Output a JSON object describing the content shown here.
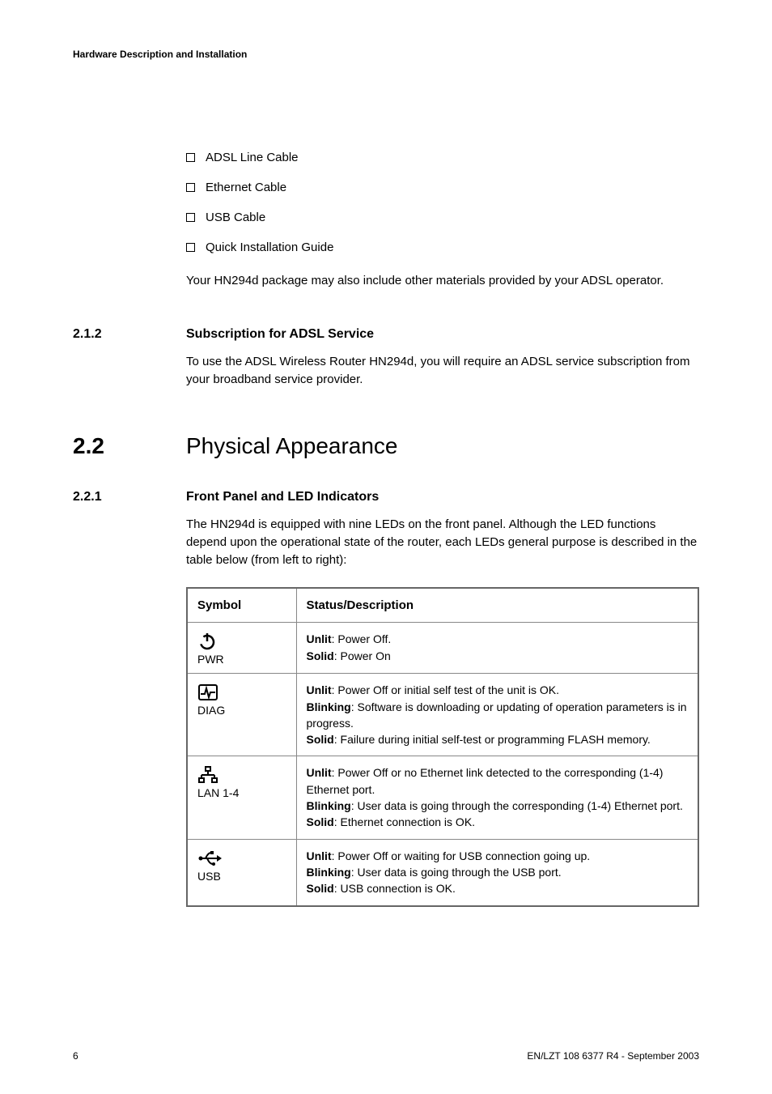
{
  "header": "Hardware Description and Installation",
  "bullets": [
    "ADSL Line Cable",
    "Ethernet Cable",
    "USB Cable",
    "Quick Installation Guide"
  ],
  "intro_para": "Your HN294d package may also include other materials provided by your ADSL operator.",
  "sec_212_num": "2.1.2",
  "sec_212_title": "Subscription for ADSL Service",
  "sec_212_body": "To use the ADSL Wireless Router HN294d, you will require an ADSL service subscription from your broadband service provider.",
  "sec_22_num": "2.2",
  "sec_22_title": "Physical Appearance",
  "sec_221_num": "2.2.1",
  "sec_221_title": "Front Panel and LED Indicators",
  "sec_221_body": "The HN294d is equipped with nine LEDs on the front panel. Although the LED functions depend upon the operational state of the router, each LEDs general purpose is described in the table below (from left to right):",
  "table": {
    "h1": "Symbol",
    "h2": "Status/Description",
    "rows": [
      {
        "label": "PWR",
        "lines": [
          {
            "b": "Unlit",
            "t": ": Power Off."
          },
          {
            "b": "Solid",
            "t": ": Power On"
          }
        ]
      },
      {
        "label": "DIAG",
        "lines": [
          {
            "b": "Unlit",
            "t": ": Power Off or initial self test of the unit is OK."
          },
          {
            "b": "Blinking",
            "t": ": Software is downloading or updating of operation parameters is in progress."
          },
          {
            "b": "Solid",
            "t": ": Failure during initial self-test or programming FLASH memory."
          }
        ]
      },
      {
        "label": "LAN 1-4",
        "lines": [
          {
            "b": "Unlit",
            "t": ": Power Off or no Ethernet link detected to the corresponding (1-4) Ethernet port."
          },
          {
            "b": "Blinking",
            "t": ": User data is going through the corresponding (1-4) Ethernet port."
          },
          {
            "b": "Solid",
            "t": ": Ethernet connection is OK."
          }
        ]
      },
      {
        "label": "USB",
        "lines": [
          {
            "b": "Unlit",
            "t": ": Power Off or waiting for USB connection going up."
          },
          {
            "b": "Blinking",
            "t": ": User data is going through the USB port."
          },
          {
            "b": "Solid",
            "t": ": USB connection is OK."
          }
        ]
      }
    ]
  },
  "footer_left": "6",
  "footer_right": "EN/LZT 108 6377 R4 - September 2003"
}
